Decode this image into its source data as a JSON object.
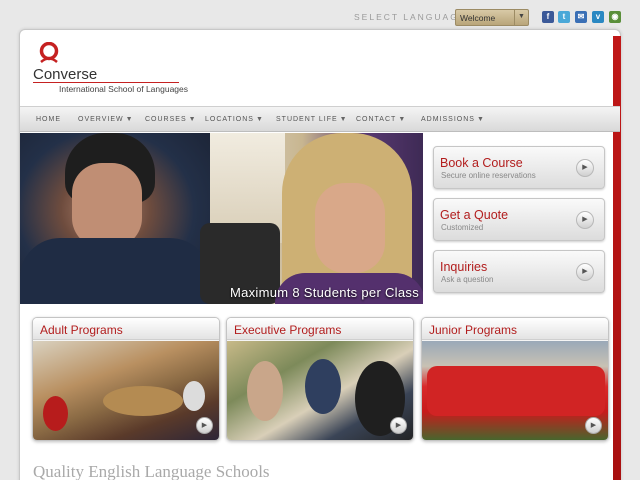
{
  "topbar": {
    "select_language_label": "SELECT LANGUAGE",
    "language_selected": "Welcome",
    "social_icons": [
      "facebook-icon",
      "twitter-icon",
      "email-icon",
      "vimeo-icon",
      "rss-icon"
    ]
  },
  "logo": {
    "name": "Converse",
    "subtitle": "International School of Languages",
    "accent_color": "#c52121"
  },
  "nav": {
    "items": [
      {
        "label": "HOME",
        "dropdown": false
      },
      {
        "label": "OVERVIEW",
        "dropdown": true
      },
      {
        "label": "COURSES",
        "dropdown": true
      },
      {
        "label": "LOCATIONS",
        "dropdown": true
      },
      {
        "label": "STUDENT LIFE",
        "dropdown": true
      },
      {
        "label": "CONTACT",
        "dropdown": true
      },
      {
        "label": "ADMISSIONS",
        "dropdown": true
      }
    ]
  },
  "hero": {
    "caption": "Maximum 8 Students per Class"
  },
  "side_buttons": [
    {
      "title": "Book a Course",
      "subtitle": "Secure online reservations"
    },
    {
      "title": "Get a Quote",
      "subtitle": "Customized"
    },
    {
      "title": "Inquiries",
      "subtitle": "Ask a question"
    }
  ],
  "programs": [
    {
      "title": "Adult Programs"
    },
    {
      "title": "Executive Programs"
    },
    {
      "title": "Junior Programs"
    }
  ],
  "main": {
    "headline": "Quality English Language Schools"
  },
  "colors": {
    "brand_red": "#b21d1d",
    "side_bar_red": "#c01818"
  }
}
